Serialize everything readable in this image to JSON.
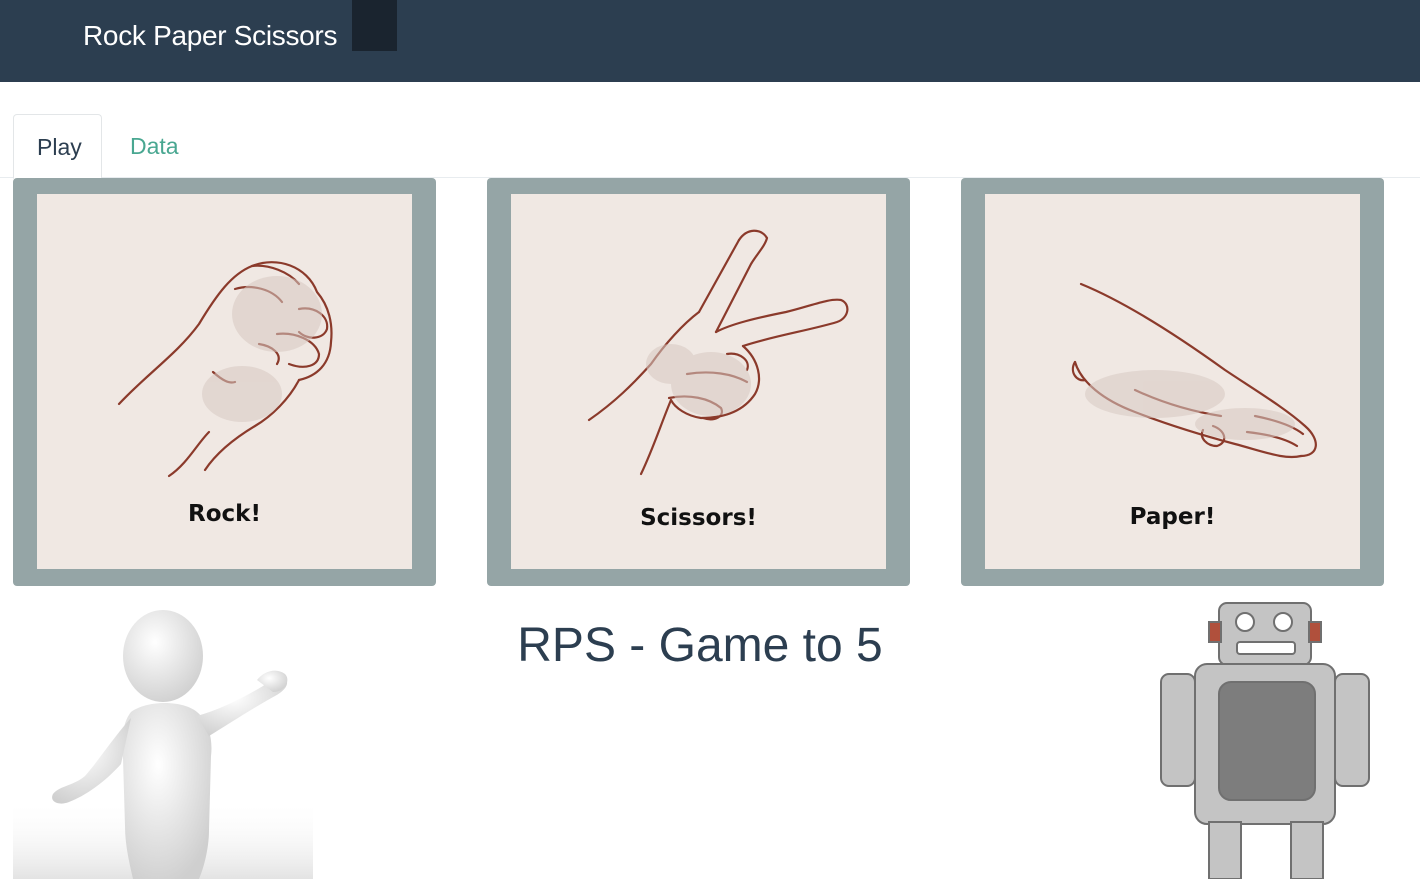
{
  "navbar": {
    "brand": "Rock Paper Scissors"
  },
  "tabs": [
    {
      "label": "Play",
      "active": true
    },
    {
      "label": "Data",
      "active": false
    }
  ],
  "choices": [
    {
      "caption": "Rock!",
      "icon": "rock-hand-icon"
    },
    {
      "caption": "Scissors!",
      "icon": "scissors-hand-icon"
    },
    {
      "caption": "Paper!",
      "icon": "paper-hand-icon"
    }
  ],
  "game": {
    "title": "RPS - Game to 5"
  },
  "players": {
    "human": "human-figure-icon",
    "computer": "robot-icon"
  },
  "colors": {
    "navbar": "#2c3e50",
    "card_frame": "#95a5a6",
    "card_bg": "#f0e8e3",
    "sketch_line": "#8b3a2b",
    "tab_link": "#49a791",
    "title_text": "#2c3e50"
  }
}
